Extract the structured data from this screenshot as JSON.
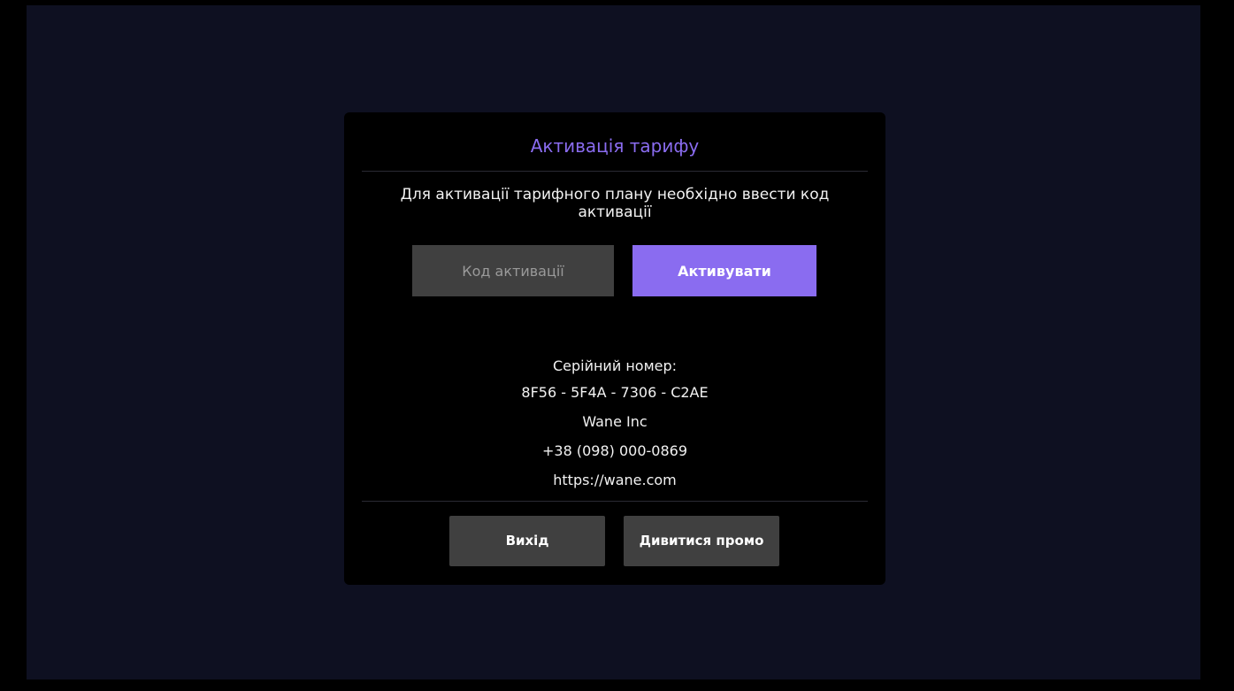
{
  "dialog": {
    "title": "Активація тарифу",
    "message": "Для активації тарифного плану необхідно ввести код активації",
    "code_input": {
      "value": "",
      "placeholder": "Код активації"
    },
    "activate_label": "Активувати",
    "serial_label": "Серійний номер:",
    "serial_value": "8F56 - 5F4A - 7306 - C2AE",
    "company": "Wane Inc",
    "phone": "+38 (098) 000-0869",
    "website": "https://wane.com",
    "exit_label": "Вихід",
    "promo_label": "Дивитися промо"
  },
  "colors": {
    "accent": "#8a6cf0",
    "screen_background": "#0e1021",
    "dialog_background": "#000000",
    "secondary_button": "#404040"
  }
}
